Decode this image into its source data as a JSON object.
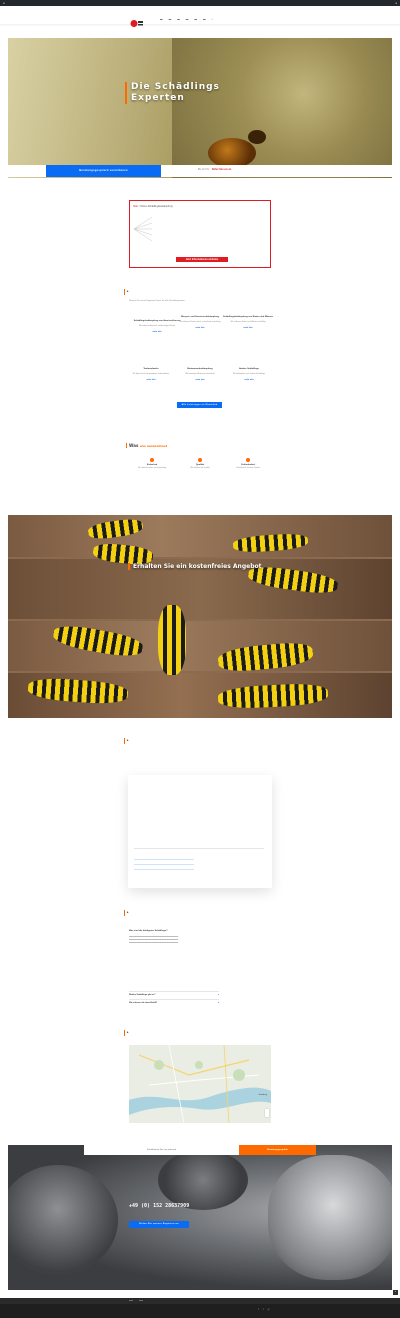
{
  "hero": {
    "title_line1": "Die Schädlings",
    "title_line2": "Experten",
    "button": "Beratungsgespräch vereinbaren",
    "info": "Bis 22 Uhr",
    "info_link": "Rufen Sie uns an"
  },
  "box": {
    "crumb": "Start",
    "title": "Online-Schädlingsbekämpfung",
    "button": "Jetzt Informationen einholen"
  },
  "services": {
    "intro": "Nutzen Sie unser Experten-Team für alle Schädlingsarten",
    "more": "mehr info",
    "items": [
      {
        "title": "Schädlingsbekämpfung von Ameisen/Larven",
        "desc": "Wir entfernen Ameisen und beseitigen Nester"
      },
      {
        "title": "Wespen- und Hornissenbekämpfung",
        "desc": "Wir entfernen Nester sicher, schnell und zuverlässig"
      },
      {
        "title": "Schädlingsbekämpfung von Ratten und Mäusen",
        "desc": "Wir entfernen Ratten und Mäuse nachhaltig"
      },
      {
        "title": "Taubenabwehr",
        "desc": "Wir bieten Ihnen die geeignete Taubenabwehr"
      },
      {
        "title": "Bettwanzenbekämpfung",
        "desc": "Wir beseitigen Bettwanzen dauerhaft"
      },
      {
        "title": "Andere Schädlinge",
        "desc": "Wir bekämpfen auch andere Schädlinge"
      }
    ],
    "all_button": "Alle Leistungen im Überblick"
  },
  "why": {
    "head_a": "Was",
    "head_b": "uns auszeichnet",
    "items": [
      {
        "title": "Sicherheit",
        "desc": "Wir arbeiten sicher und zuverlässig"
      },
      {
        "title": "Qualität",
        "desc": "Wir arbeiten mit Qualität"
      },
      {
        "title": "Zufriedenheit",
        "desc": "Zufriedenheit unserer Kunden"
      }
    ]
  },
  "offer": {
    "title": "Erhalten Sie ein kostenfreies Angebot"
  },
  "faq": {
    "q1": "Was sind die häufigsten Schädlinge?",
    "q2": "Welche Schädlinge gibt es?",
    "q3": "Wie erkenne ich einen Befall?"
  },
  "contact": {
    "strip": "Kontaktieren Sie uns jederzeit",
    "strip_button": "Beratungsgespräch",
    "phone": "+49 (0) 152 28637909",
    "button": "Rufen Sie unsere Experten an"
  },
  "map": {
    "city": "Hamburg"
  },
  "colors": {
    "accent": "#ff6a00",
    "blue": "#0a6cf5",
    "red": "#e11b22"
  }
}
